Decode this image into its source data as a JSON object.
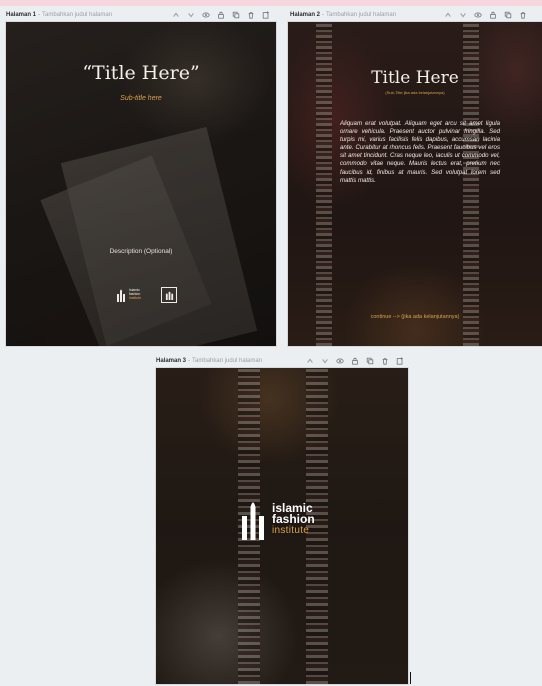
{
  "pages": [
    {
      "label": "Halaman 1",
      "title_hint": "Tambahkan judul halaman",
      "title": "“Title Here”",
      "subtitle": "Sub-title here",
      "description": "Description (Optional)",
      "logo_text": [
        "Islamic",
        "fashion",
        "institute"
      ]
    },
    {
      "label": "Halaman 2",
      "title_hint": "Tambahkan judul halaman",
      "title": "Title Here",
      "subtitle": "(Sub-Title jika ada kelanjutannya)",
      "body": "Aliquam erat volutpat. Aliquam eget arcu sit amet ligula ornare vehicula. Praesent auctor pulvinar fringilla. Sed turpis mi, varius facilisis felis dapibus, accumsan lacinia ante. Curabitur at rhoncus felis. Praesent faucibus vel eros sit amet tincidunt. Cras neque leo, iaculis ut commodo vel, commodo vitae neque. Mauris lectus erat, pretium nec faucibus id, finibus at mauris. Sed volutpat lorem sed mattis mattis.",
      "continue": "continue --> (jika ada kelanjutannya)"
    },
    {
      "label": "Halaman 3",
      "title_hint": "Tambahkan judul halaman",
      "logo_text": [
        "islamic",
        "fashion",
        "institute"
      ]
    }
  ],
  "separator": "-",
  "toolbar_icons": [
    "chevron-up-icon",
    "chevron-down-icon",
    "eye-icon",
    "lock-icon",
    "duplicate-icon",
    "trash-icon",
    "add-page-icon"
  ],
  "colors": {
    "accent_gold": "#d8a24a",
    "page_text": "#f4efe8",
    "app_bg": "#eceff1"
  }
}
